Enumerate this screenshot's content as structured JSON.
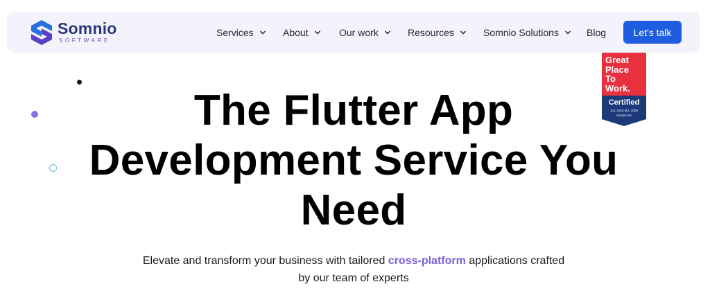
{
  "brand": {
    "name": "Somnio",
    "tagline": "SOFTWARE",
    "colors": {
      "primary": "#2b3a7a",
      "accent": "#6a55c4",
      "cta": "#1e5de0"
    }
  },
  "nav": {
    "items": [
      {
        "label": "Services",
        "has_dropdown": true
      },
      {
        "label": "About",
        "has_dropdown": true
      },
      {
        "label": "Our work",
        "has_dropdown": true
      },
      {
        "label": "Resources",
        "has_dropdown": true
      },
      {
        "label": "Somnio Solutions",
        "has_dropdown": true
      },
      {
        "label": "Blog",
        "has_dropdown": false
      }
    ],
    "cta_label": "Let's talk"
  },
  "badge": {
    "lines": [
      "Great",
      "Place",
      "To",
      "Work."
    ],
    "certified": "Certified",
    "dates": "JUL 2024-JUL 2025",
    "country": "URUGUAY",
    "colors": {
      "top": "#e8303f",
      "bottom": "#1c3a7a"
    }
  },
  "hero": {
    "title_lines": [
      "The Flutter App",
      "Development Service You",
      "Need"
    ],
    "subtitle_before": "Elevate and transform your business with tailored ",
    "subtitle_highlight": "cross-platform",
    "subtitle_after": " applications crafted",
    "subtitle_line2": "by our team of experts"
  }
}
